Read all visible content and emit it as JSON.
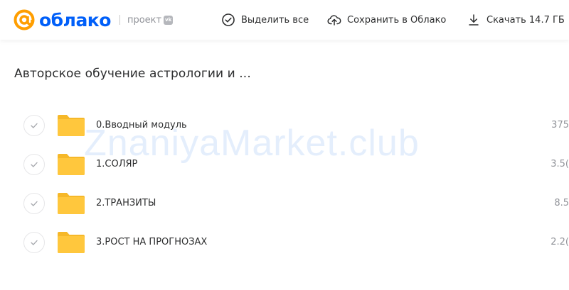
{
  "header": {
    "logo_text": "облако",
    "project_label": "проект",
    "vk_badge": "vk",
    "actions": {
      "select_all": "Выделить все",
      "save_to_cloud": "Сохранить в Облако",
      "download": "Скачать 14.7 ГБ"
    }
  },
  "folder": {
    "title": "Авторское обучение астрологии и ..."
  },
  "items": [
    {
      "name": "0.Вводный модуль",
      "size": "375"
    },
    {
      "name": "1.СОЛЯР",
      "size": "3.5("
    },
    {
      "name": "2.ТРАНЗИТЫ",
      "size": "8.5"
    },
    {
      "name": "3.РОСТ НА ПРОГНОЗАХ",
      "size": "2.2("
    }
  ],
  "watermark": "ZnaniyaMarket.club",
  "colors": {
    "brand_blue": "#005ff9",
    "brand_orange": "#ff9e00",
    "folder_yellow": "#ffc73d",
    "muted_text": "#919399"
  }
}
